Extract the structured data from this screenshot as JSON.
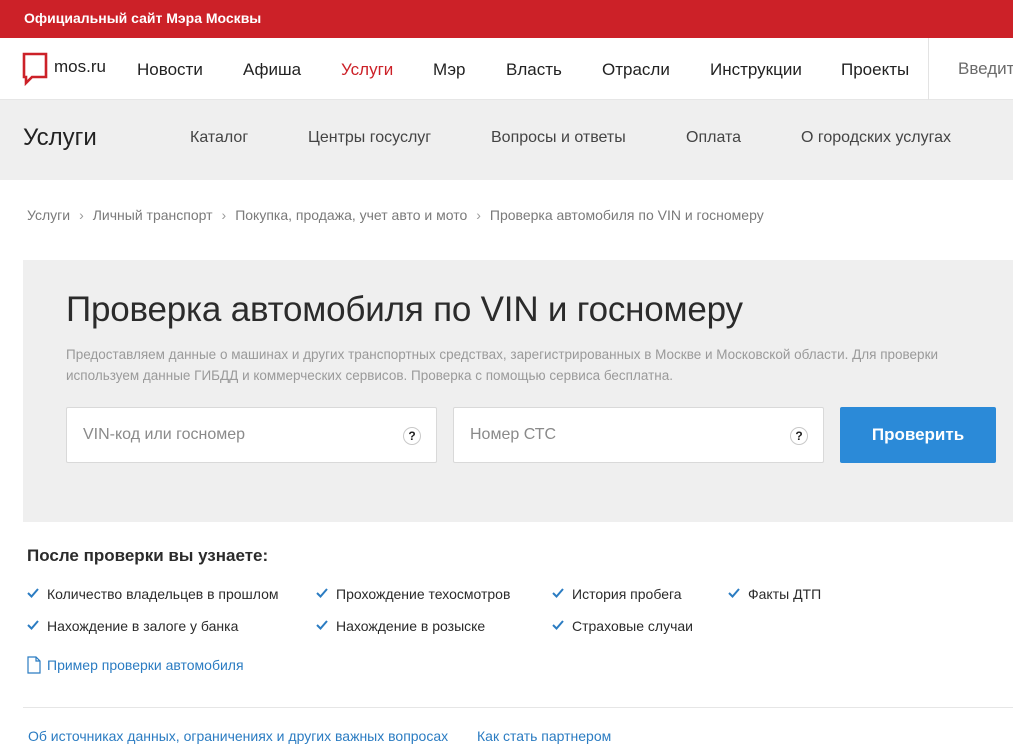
{
  "topbar": {
    "text": "Официальный сайт Мэра Москвы"
  },
  "logo": {
    "text": "mos.ru"
  },
  "nav": {
    "items": [
      "Новости",
      "Афиша",
      "Услуги",
      "Мэр",
      "Власть",
      "Отрасли",
      "Инструкции",
      "Проекты"
    ],
    "active": "Услуги",
    "search_placeholder": "Введите запрос"
  },
  "subnav": {
    "title": "Услуги",
    "items": [
      "Каталог",
      "Центры госуслуг",
      "Вопросы и ответы",
      "Оплата",
      "О городских услугах"
    ]
  },
  "breadcrumb": [
    "Услуги",
    "Личный транспорт",
    "Покупка, продажа, учет авто и мото",
    "Проверка автомобиля по VIN и госномеру"
  ],
  "panel": {
    "title": "Проверка автомобиля по VIN и госномеру",
    "description": "Предоставляем данные о машинах и других транспортных средствах, зарегистрированных в Москве и Московской области. Для проверки используем данные ГИБДД и коммерческих сервисов. Проверка с помощью сервиса бесплатна.",
    "vin_placeholder": "VIN-код или госномер",
    "sts_placeholder": "Номер СТС",
    "help_symbol": "?",
    "button_label": "Проверить"
  },
  "learn": {
    "title": "После проверки вы узнаете:",
    "features": [
      "Количество владельцев в прошлом",
      "Прохождение техосмотров",
      "История пробега",
      "Факты ДТП",
      "Нахождение в залоге у банка",
      "Нахождение в розыске",
      "Страховые случаи"
    ]
  },
  "sample_link": "Пример проверки автомобиля",
  "footer_links": [
    "Об источниках данных, ограничениях и других важных вопросах",
    "Как стать партнером"
  ],
  "colors": {
    "brand_red": "#cc2128",
    "button_blue": "#2b8ad8",
    "link_blue": "#2b7cc2",
    "panel_gray": "#efefef"
  },
  "icons": {
    "logo": "speech-bubble-icon",
    "check": "checkmark-icon",
    "document": "document-icon",
    "help": "question-icon"
  }
}
